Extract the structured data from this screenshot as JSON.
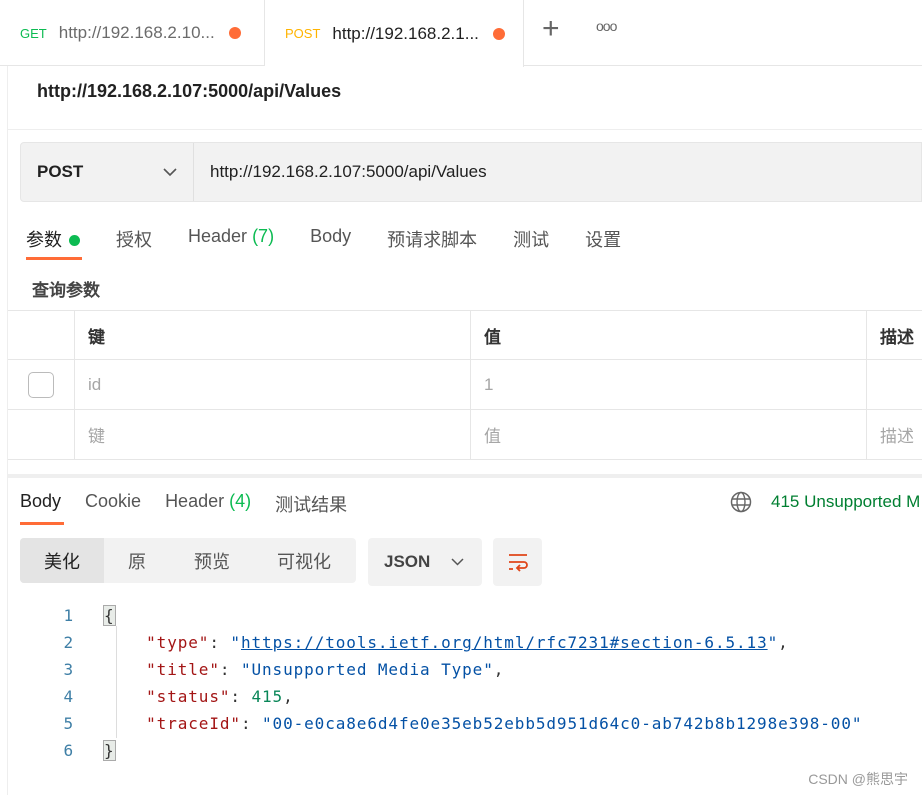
{
  "tabs": [
    {
      "method": "GET",
      "label": "http://192.168.2.10...",
      "method_color": "#0cbb52"
    },
    {
      "method": "POST",
      "label": "http://192.168.2.1...",
      "method_color": "#ffb400"
    }
  ],
  "request": {
    "title": "http://192.168.2.107:5000/api/Values",
    "method": "POST",
    "url": "http://192.168.2.107:5000/api/Values"
  },
  "req_tabs": {
    "params": "参数",
    "auth": "授权",
    "header": "Header",
    "header_count": "(7)",
    "body": "Body",
    "prescript": "预请求脚本",
    "tests": "测试",
    "settings": "设置"
  },
  "query": {
    "title": "查询参数",
    "headers": [
      "键",
      "值",
      "描述"
    ],
    "rows": [
      {
        "key": "id",
        "value": "1"
      }
    ],
    "placeholders": [
      "键",
      "值",
      "描述"
    ]
  },
  "response": {
    "tabs": {
      "body": "Body",
      "cookie": "Cookie",
      "header": "Header",
      "header_count": "(4)",
      "tests": "测试结果"
    },
    "status": "415 Unsupported M",
    "views": [
      "美化",
      "原",
      "预览",
      "可视化"
    ],
    "format": "JSON"
  },
  "code": {
    "lines": [
      "1",
      "2",
      "3",
      "4",
      "5",
      "6"
    ],
    "open": "{",
    "close": "}",
    "type_key": "\"type\"",
    "type_val": "https://tools.ietf.org/html/rfc7231#section-6.5.13",
    "title_key": "\"title\"",
    "title_val": "\"Unsupported Media Type\"",
    "status_key": "\"status\"",
    "status_val": "415",
    "trace_key": "\"traceId\"",
    "trace_val": "\"00-e0ca8e6d4fe0e35eb52ebb5d951d64c0-ab742b8b1298e398-00\""
  },
  "watermark": "CSDN @熊思宇",
  "colors": {
    "accent": "#ff6c37",
    "success": "#0cbb52",
    "status": "#007f31"
  }
}
